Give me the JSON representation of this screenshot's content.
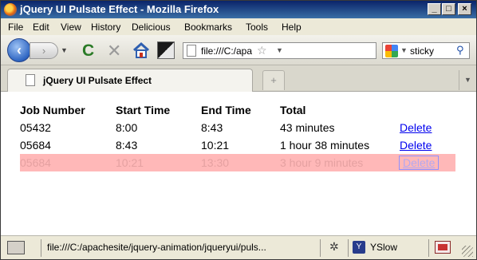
{
  "window": {
    "title": "jQuery UI Pulsate Effect - Mozilla Firefox"
  },
  "menu": [
    "File",
    "Edit",
    "View",
    "History",
    "Delicious",
    "Bookmarks",
    "Tools",
    "Help"
  ],
  "nav": {
    "url": "file:///C:/apacl",
    "search_text": "sticky"
  },
  "tab": {
    "title": "jQuery UI Pulsate Effect"
  },
  "table": {
    "headers": [
      "Job Number",
      "Start Time",
      "End Time",
      "Total"
    ],
    "rows": [
      {
        "job": "05432",
        "start": "8:00",
        "end": "8:43",
        "total": "43 minutes",
        "action": "Delete"
      },
      {
        "job": "05684",
        "start": "8:43",
        "end": "10:21",
        "total": "1 hour 38 minutes",
        "action": "Delete"
      },
      {
        "job": "05684",
        "start": "10:21",
        "end": "13:30",
        "total": "3 hour 9 minutes",
        "action": "Delete"
      }
    ]
  },
  "status": {
    "url": "file:///C:/apachesite/jquery-animation/jqueryui/puls...",
    "yslow": "YSlow"
  },
  "colors": {
    "pulse_highlight": "#ffb8b8",
    "link": "#0000ee"
  }
}
